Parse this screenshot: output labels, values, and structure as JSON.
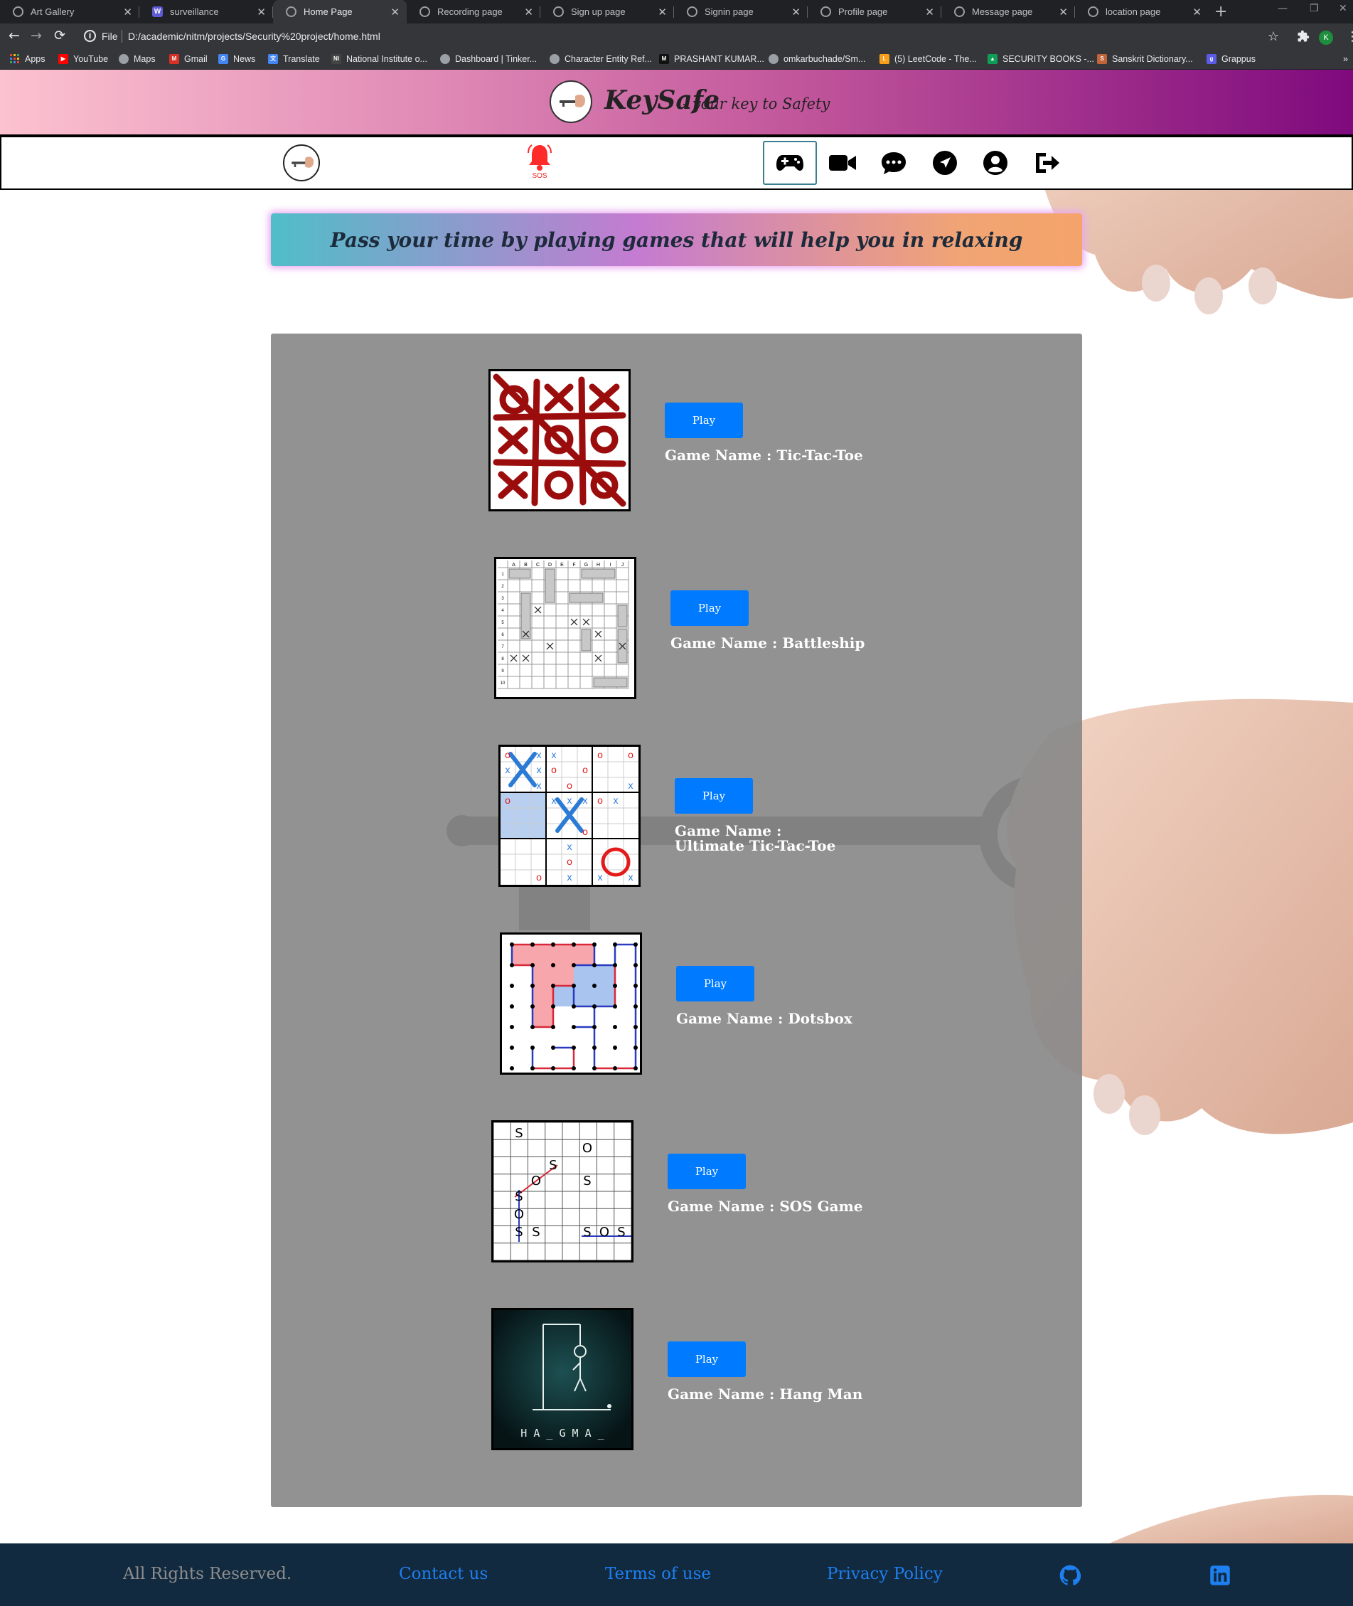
{
  "browser": {
    "tabs": [
      {
        "title": "Art Gallery",
        "active": false,
        "icon": "globe-icon"
      },
      {
        "title": "surveillance",
        "active": false,
        "icon": "w-icon"
      },
      {
        "title": "Home Page",
        "active": true,
        "icon": "globe-icon"
      },
      {
        "title": "Recording page",
        "active": false,
        "icon": "globe-icon"
      },
      {
        "title": "Sign up page",
        "active": false,
        "icon": "globe-icon"
      },
      {
        "title": "Signin page",
        "active": false,
        "icon": "globe-icon"
      },
      {
        "title": "Profile page",
        "active": false,
        "icon": "globe-icon"
      },
      {
        "title": "Message page",
        "active": false,
        "icon": "globe-icon"
      },
      {
        "title": "location page",
        "active": false,
        "icon": "globe-icon"
      }
    ],
    "address": {
      "scheme_label": "File",
      "url": "D:/academic/nitm/projects/Security%20project/home.html"
    },
    "profile_initial": "K",
    "bookmarks": [
      {
        "label": "Apps",
        "color": "#ea4335"
      },
      {
        "label": "YouTube",
        "color": "#ff0000"
      },
      {
        "label": "Maps",
        "color": "#9aa0a6"
      },
      {
        "label": "Gmail",
        "color": "#d93025"
      },
      {
        "label": "News",
        "color": "#4285f4"
      },
      {
        "label": "Translate",
        "color": "#4285f4"
      },
      {
        "label": "National Institute o...",
        "color": "#444444"
      },
      {
        "label": "Dashboard | Tinker...",
        "color": "#9aa0a6"
      },
      {
        "label": "Character Entity Ref...",
        "color": "#9aa0a6"
      },
      {
        "label": "PRASHANT KUMAR...",
        "color": "#111111"
      },
      {
        "label": "omkarbuchade/Sm...",
        "color": "#9aa0a6"
      },
      {
        "label": "(5) LeetCode - The...",
        "color": "#f89f1b"
      },
      {
        "label": "SECURITY BOOKS -...",
        "color": "#0f9d58"
      },
      {
        "label": "Sanskrit Dictionary...",
        "color": "#c1643a"
      },
      {
        "label": "Grappus",
        "color": "#5a5be6"
      }
    ]
  },
  "header": {
    "brand_name": "KeySafe",
    "tagline": "- your key to Safety"
  },
  "navbar": {
    "sos_label": "SOS",
    "icons": [
      "gamepad-icon",
      "video-camera-icon",
      "chat-bubble-icon",
      "location-arrow-icon",
      "user-circle-icon",
      "logout-icon"
    ]
  },
  "hero": {
    "text": "Pass your time by playing games that will help you in relaxing"
  },
  "games": [
    {
      "play_label": "Play",
      "name": "Game Name : Tic-Tac-Toe"
    },
    {
      "play_label": "Play",
      "name": "Game Name : Battleship"
    },
    {
      "play_label": "Play",
      "name": "Game Name : Ultimate Tic-Tac-Toe"
    },
    {
      "play_label": "Play",
      "name": "Game Name : Dotsbox"
    },
    {
      "play_label": "Play",
      "name": "Game Name : SOS Game"
    },
    {
      "play_label": "Play",
      "name": "Game Name : Hang Man"
    }
  ],
  "game_thumbnails": {
    "battleship_cols": [
      "A",
      "B",
      "C",
      "D",
      "E",
      "F",
      "G",
      "H",
      "I",
      "J"
    ],
    "battleship_rows": [
      "1",
      "2",
      "3",
      "4",
      "5",
      "6",
      "7",
      "8",
      "9",
      "10"
    ],
    "sos_cells": [
      "S",
      "O",
      "S",
      "O",
      "S",
      "S",
      "O",
      "S",
      "S",
      "S",
      "O",
      "S"
    ],
    "hangman_word": "H A _ G M A _"
  },
  "footer": {
    "copyright": "All Rights Reserved.",
    "links": [
      "Contact us",
      "Terms of use",
      "Privacy Policy"
    ],
    "icons": [
      "github-icon",
      "linkedin-icon"
    ]
  },
  "colors": {
    "accent_button": "#007bff",
    "footer_bg": "#122a3f",
    "panel_bg": "#919191",
    "sos_red": "#ff2a2a"
  }
}
